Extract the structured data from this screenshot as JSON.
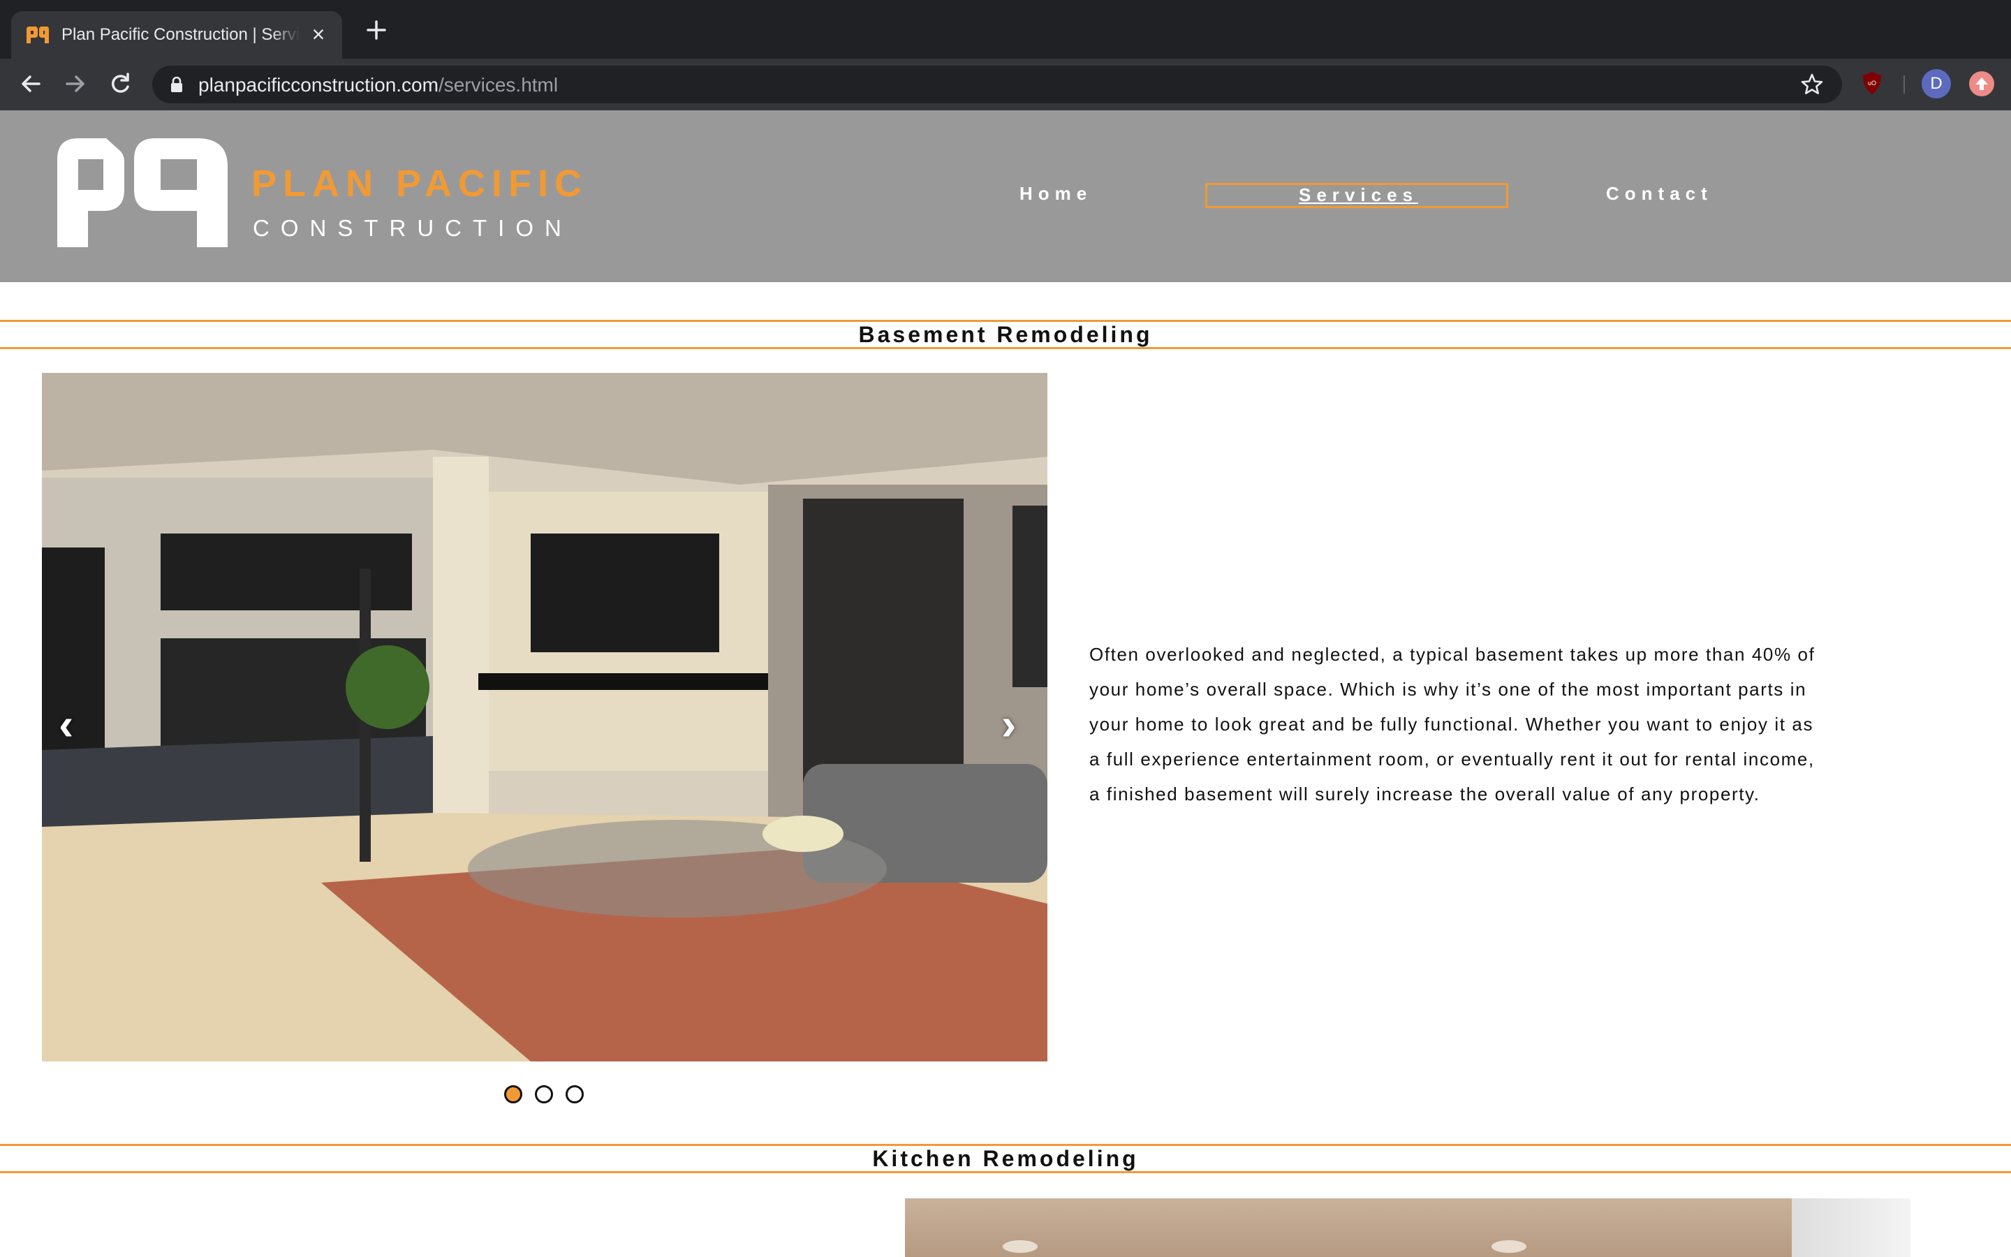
{
  "browser": {
    "tab_title": "Plan Pacific Construction | Services",
    "url_domain": "planpacificconstruction.com",
    "url_path": "/services.html",
    "profile_initial": "D"
  },
  "site": {
    "brand_top": "PLAN PACIFIC",
    "brand_bottom": "CONSTRUCTION",
    "nav": [
      "Home",
      "Services",
      "Contact"
    ],
    "active_nav": "Services",
    "accent_color": "#f19a34",
    "header_color": "#999999"
  },
  "sections": [
    {
      "heading": "Basement Remodeling",
      "description": "Often overlooked and neglected, a typical basement takes up more than 40% of your home’s overall space. Which is why it’s one of the most important parts in your home to look great and be fully functional. Whether you want to enjoy it as a full experience entertainment room, or eventually rent it out for rental income, a finished basement will surely increase the overall value of any property.",
      "carousel": {
        "prev": "‹",
        "next": "›",
        "slides": 3,
        "active_slide": 1
      }
    },
    {
      "heading": "Kitchen Remodeling"
    }
  ]
}
